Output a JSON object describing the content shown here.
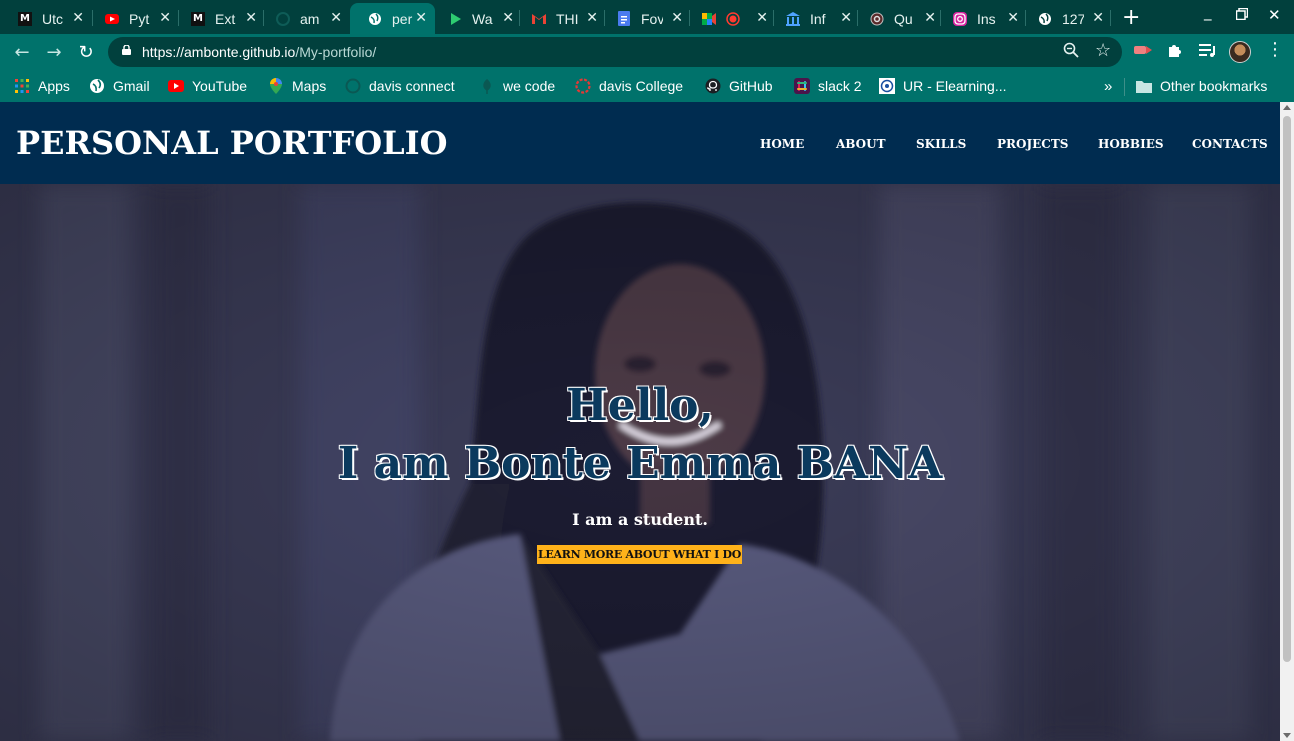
{
  "browser": {
    "tabs": [
      {
        "title": "Utc",
        "icon": "medium-icon",
        "active": false
      },
      {
        "title": "Pyt",
        "icon": "youtube-icon",
        "active": false
      },
      {
        "title": "Ext",
        "icon": "medium-icon",
        "active": false
      },
      {
        "title": "am",
        "icon": "github-icon",
        "active": false
      },
      {
        "title": "per",
        "icon": "globe-icon",
        "active": true
      },
      {
        "title": "Wa",
        "icon": "play-icon",
        "active": false
      },
      {
        "title": "THI",
        "icon": "gmail-icon",
        "active": false
      },
      {
        "title": "Fov",
        "icon": "docs-icon",
        "active": false
      },
      {
        "title": "",
        "icon": "meet-icon",
        "active": false
      },
      {
        "title": "Inf",
        "icon": "institution-icon",
        "active": false
      },
      {
        "title": "Qu",
        "icon": "quora-icon",
        "active": false
      },
      {
        "title": "Ins",
        "icon": "instagram-icon",
        "active": false
      },
      {
        "title": "127",
        "icon": "globe-icon",
        "active": false
      }
    ],
    "url_host": "https://ambonte.github.io",
    "url_path": "/My-portfolio/",
    "bookmarks": [
      {
        "label": "Apps",
        "icon": "apps-grid-icon"
      },
      {
        "label": "Gmail",
        "icon": "globe-icon"
      },
      {
        "label": "YouTube",
        "icon": "youtube-icon"
      },
      {
        "label": "Maps",
        "icon": "maps-icon"
      },
      {
        "label": "davis connect",
        "icon": "github-icon"
      },
      {
        "label": "we code",
        "icon": "leaf-icon"
      },
      {
        "label": "davis College",
        "icon": "ring-icon"
      },
      {
        "label": "GitHub",
        "icon": "github-icon"
      },
      {
        "label": "slack 2",
        "icon": "slack-icon"
      },
      {
        "label": "UR - Elearning...",
        "icon": "ur-icon"
      }
    ],
    "overflow_label": "»",
    "other_bookmarks": "Other bookmarks"
  },
  "site": {
    "brand": "PERSONAL PORTFOLIO",
    "nav": [
      "HOME",
      "ABOUT",
      "SKILLS",
      "PROJECTS",
      "HOBBIES",
      "CONTACTS"
    ],
    "hero_line1": "Hello,",
    "hero_line2": "I am Bonte Emma BANA",
    "hero_sub": "I am a student.",
    "hero_cta": "LEARN MORE ABOUT WHAT I DO"
  },
  "colors": {
    "tabstrip": "#01403d",
    "toolbar": "#00726b",
    "site_header": "#002c50",
    "hero_overlay": "#3a3b55",
    "cta": "#ffb21a"
  }
}
